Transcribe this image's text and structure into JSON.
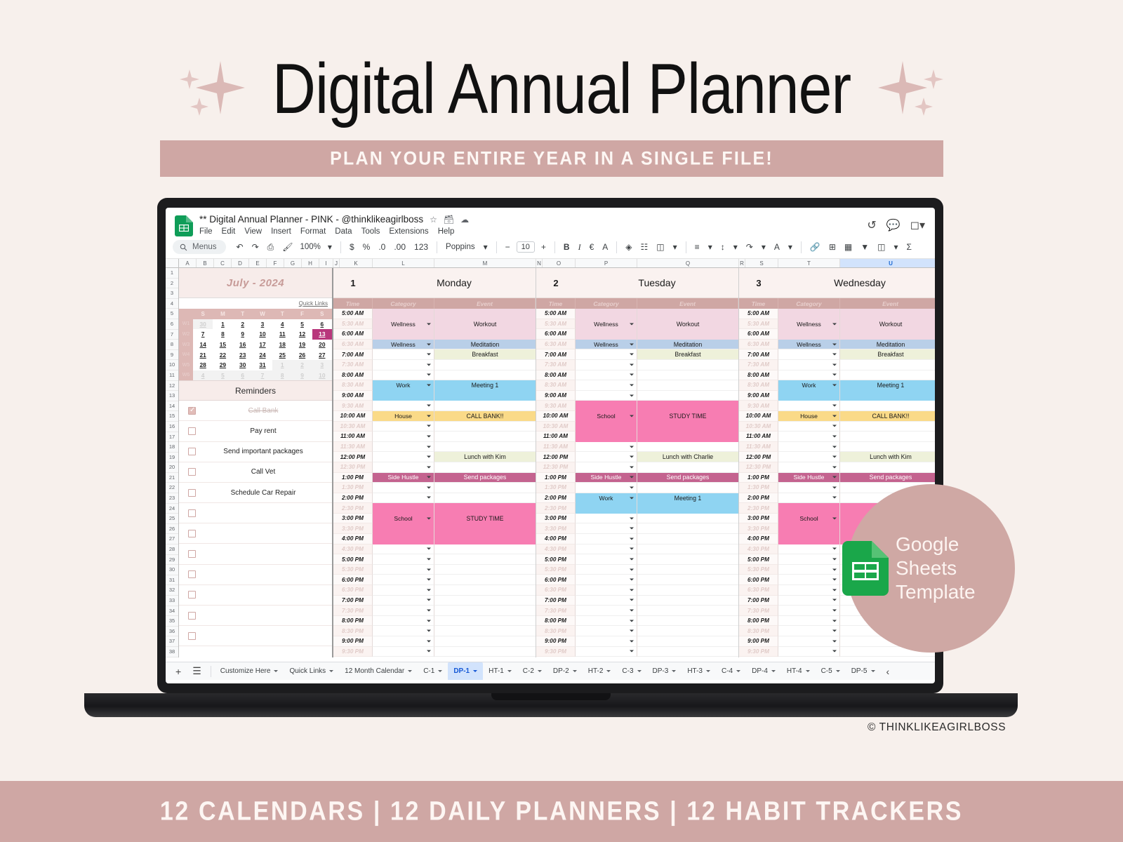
{
  "header": {
    "title": "Digital Annual Planner",
    "banner": "PLAN YOUR ENTIRE YEAR IN A SINGLE FILE!"
  },
  "footer": {
    "text": "12 CALENDARS | 12 DAILY PLANNERS |  12 HABIT TRACKERS"
  },
  "badge": {
    "line1": "Google",
    "line2": "Sheets",
    "line3": "Template"
  },
  "copyright": "© THINKLIKEAGIRLBOSS",
  "app": {
    "filename": "** Digital Annual Planner - PINK - @thinklikeagirlboss",
    "menus": [
      "File",
      "Edit",
      "View",
      "Insert",
      "Format",
      "Data",
      "Tools",
      "Extensions",
      "Help"
    ],
    "toolbar": {
      "search_label": "Menus",
      "zoom": "100%",
      "currency": "$",
      "percent": "%",
      "dec_dec": ".0",
      "dec_inc": ".00",
      "num_format": "123",
      "font": "Poppins",
      "font_size": "10",
      "minus": "−",
      "plus": "+",
      "bold": "B",
      "italic": "I",
      "sigma": "Σ"
    }
  },
  "grid": {
    "columns": [
      "A",
      "B",
      "C",
      "D",
      "E",
      "F",
      "G",
      "H",
      "I",
      "J",
      "K",
      "L",
      "M",
      "N",
      "O",
      "P",
      "Q",
      "R",
      "S",
      "T",
      "U"
    ],
    "selected_column": "U",
    "row_numbers": [
      1,
      2,
      3,
      4,
      5,
      6,
      7,
      8,
      9,
      10,
      11,
      12,
      13,
      14,
      15,
      16,
      17,
      18,
      19,
      20,
      21,
      22,
      23,
      24,
      25,
      26,
      27,
      28,
      29,
      30,
      31,
      32,
      33,
      34,
      35,
      36,
      37,
      38
    ]
  },
  "sidebar": {
    "month_title": "July - 2024",
    "quick_links": "Quick Links",
    "dow": [
      "S",
      "M",
      "T",
      "W",
      "T",
      "F",
      "S"
    ],
    "week_labels": [
      "W1",
      "W2",
      "W3",
      "W4",
      "W5",
      "W6"
    ],
    "weeks": [
      [
        {
          "d": "30",
          "dim": true
        },
        {
          "d": "1"
        },
        {
          "d": "2"
        },
        {
          "d": "3"
        },
        {
          "d": "4"
        },
        {
          "d": "5"
        },
        {
          "d": "6"
        }
      ],
      [
        {
          "d": "7"
        },
        {
          "d": "8"
        },
        {
          "d": "9"
        },
        {
          "d": "10"
        },
        {
          "d": "11"
        },
        {
          "d": "12"
        },
        {
          "d": "13",
          "today": true
        }
      ],
      [
        {
          "d": "14"
        },
        {
          "d": "15"
        },
        {
          "d": "16"
        },
        {
          "d": "17"
        },
        {
          "d": "18"
        },
        {
          "d": "19"
        },
        {
          "d": "20"
        }
      ],
      [
        {
          "d": "21"
        },
        {
          "d": "22"
        },
        {
          "d": "23"
        },
        {
          "d": "24"
        },
        {
          "d": "25"
        },
        {
          "d": "26"
        },
        {
          "d": "27"
        }
      ],
      [
        {
          "d": "28"
        },
        {
          "d": "29"
        },
        {
          "d": "30"
        },
        {
          "d": "31"
        },
        {
          "d": "1",
          "dim": true
        },
        {
          "d": "2",
          "dim": true
        },
        {
          "d": "3",
          "dim": true
        }
      ],
      [
        {
          "d": "4",
          "dim": true
        },
        {
          "d": "5",
          "dim": true
        },
        {
          "d": "6",
          "dim": true
        },
        {
          "d": "7",
          "dim": true
        },
        {
          "d": "8",
          "dim": true
        },
        {
          "d": "9",
          "dim": true
        },
        {
          "d": "10",
          "dim": true
        }
      ]
    ],
    "reminders_title": "Reminders",
    "reminders": [
      {
        "text": "Call Bank",
        "checked": true
      },
      {
        "text": "Pay rent",
        "checked": false
      },
      {
        "text": "Send important packages",
        "checked": false
      },
      {
        "text": "Call Vet",
        "checked": false
      },
      {
        "text": "Schedule Car Repair",
        "checked": false
      },
      {
        "text": "",
        "checked": false
      },
      {
        "text": "",
        "checked": false
      },
      {
        "text": "",
        "checked": false
      },
      {
        "text": "",
        "checked": false
      },
      {
        "text": "",
        "checked": false
      },
      {
        "text": "",
        "checked": false
      },
      {
        "text": "",
        "checked": false
      }
    ]
  },
  "schedule": {
    "sub_headers": [
      "Time",
      "Category",
      "Event"
    ],
    "times": [
      "5:00 AM",
      "5:30 AM",
      "6:00 AM",
      "6:30 AM",
      "7:00 AM",
      "7:30 AM",
      "8:00 AM",
      "8:30 AM",
      "9:00 AM",
      "9:30 AM",
      "10:00 AM",
      "10:30 AM",
      "11:00 AM",
      "11:30 AM",
      "12:00 PM",
      "12:30 PM",
      "1:00 PM",
      "1:30 PM",
      "2:00 PM",
      "2:30 PM",
      "3:00 PM",
      "3:30 PM",
      "4:00 PM",
      "4:30 PM",
      "5:00 PM",
      "5:30 PM",
      "6:00 PM",
      "6:30 PM",
      "7:00 PM",
      "7:30 PM",
      "8:00 PM",
      "8:30 PM",
      "9:00 PM",
      "9:30 PM"
    ],
    "colors": {
      "wellness_pink": "#f2d7e2",
      "wellness_blue": "#b9cfe8",
      "breakfast": "#eef1da",
      "work": "#8fd4f2",
      "house": "#fada88",
      "side_hustle": "#c4638f",
      "school": "#f77db2",
      "lunch": "#eef1da",
      "white": "#ffffff"
    },
    "days": [
      {
        "num": "1",
        "name": "Monday",
        "entries": [
          {
            "start": 0,
            "span": 3,
            "cat": "Wellness",
            "evt": "Workout",
            "bg": "#f2d7e2",
            "fg": "#1a1a1a"
          },
          {
            "start": 3,
            "span": 1,
            "cat": "Wellness",
            "evt": "Meditation",
            "bg": "#b9cfe8",
            "fg": "#1a1a1a"
          },
          {
            "start": 4,
            "span": 1,
            "cat": "",
            "evt": "Breakfast",
            "bg": "#eef1da",
            "fg": "#1a1a1a",
            "evtonly": true
          },
          {
            "start": 7,
            "span": 2,
            "cat": "Work",
            "evt": "Meeting 1",
            "bg": "#8fd4f2",
            "fg": "#1a1a1a"
          },
          {
            "start": 10,
            "span": 1,
            "cat": "House",
            "evt": "CALL BANK!!",
            "bg": "#fada88",
            "fg": "#1a1a1a"
          },
          {
            "start": 14,
            "span": 1,
            "cat": "",
            "evt": "Lunch with Kim",
            "bg": "#eef1da",
            "fg": "#1a1a1a",
            "evtonly": true
          },
          {
            "start": 16,
            "span": 1,
            "cat": "Side Hustle",
            "evt": "Send packages",
            "bg": "#c4638f",
            "fg": "#ffffff"
          },
          {
            "start": 19,
            "span": 4,
            "cat": "School",
            "evt": "STUDY TIME",
            "bg": "#f77db2",
            "fg": "#1a1a1a"
          }
        ]
      },
      {
        "num": "2",
        "name": "Tuesday",
        "entries": [
          {
            "start": 0,
            "span": 3,
            "cat": "Wellness",
            "evt": "Workout",
            "bg": "#f2d7e2",
            "fg": "#1a1a1a"
          },
          {
            "start": 3,
            "span": 1,
            "cat": "Wellness",
            "evt": "Meditation",
            "bg": "#b9cfe8",
            "fg": "#1a1a1a"
          },
          {
            "start": 4,
            "span": 1,
            "cat": "",
            "evt": "Breakfast",
            "bg": "#eef1da",
            "fg": "#1a1a1a",
            "evtonly": true
          },
          {
            "start": 9,
            "span": 4,
            "cat": "School",
            "evt": "STUDY TIME",
            "bg": "#f77db2",
            "fg": "#1a1a1a"
          },
          {
            "start": 14,
            "span": 1,
            "cat": "",
            "evt": "Lunch with Charlie",
            "bg": "#eef1da",
            "fg": "#1a1a1a",
            "evtonly": true
          },
          {
            "start": 16,
            "span": 1,
            "cat": "Side Hustle",
            "evt": "Send packages",
            "bg": "#c4638f",
            "fg": "#ffffff"
          },
          {
            "start": 18,
            "span": 2,
            "cat": "Work",
            "evt": "Meeting 1",
            "bg": "#8fd4f2",
            "fg": "#1a1a1a"
          }
        ]
      },
      {
        "num": "3",
        "name": "Wednesday",
        "entries": [
          {
            "start": 0,
            "span": 3,
            "cat": "Wellness",
            "evt": "Workout",
            "bg": "#f2d7e2",
            "fg": "#1a1a1a"
          },
          {
            "start": 3,
            "span": 1,
            "cat": "Wellness",
            "evt": "Meditation",
            "bg": "#b9cfe8",
            "fg": "#1a1a1a"
          },
          {
            "start": 4,
            "span": 1,
            "cat": "",
            "evt": "Breakfast",
            "bg": "#eef1da",
            "fg": "#1a1a1a",
            "evtonly": true
          },
          {
            "start": 7,
            "span": 2,
            "cat": "Work",
            "evt": "Meeting 1",
            "bg": "#8fd4f2",
            "fg": "#1a1a1a"
          },
          {
            "start": 10,
            "span": 1,
            "cat": "House",
            "evt": "CALL BANK!!",
            "bg": "#fada88",
            "fg": "#1a1a1a"
          },
          {
            "start": 14,
            "span": 1,
            "cat": "",
            "evt": "Lunch with Kim",
            "bg": "#eef1da",
            "fg": "#1a1a1a",
            "evtonly": true
          },
          {
            "start": 16,
            "span": 1,
            "cat": "Side Hustle",
            "evt": "Send packages",
            "bg": "#c4638f",
            "fg": "#ffffff"
          },
          {
            "start": 19,
            "span": 4,
            "cat": "School",
            "evt": "",
            "bg": "#f77db2",
            "fg": "#1a1a1a"
          }
        ]
      }
    ]
  },
  "sheet_tabs": [
    {
      "label": "Customize Here",
      "active": false
    },
    {
      "label": "Quick Links",
      "active": false
    },
    {
      "label": "12 Month Calendar",
      "active": false
    },
    {
      "label": "C-1",
      "active": false
    },
    {
      "label": "DP-1",
      "active": true
    },
    {
      "label": "HT-1",
      "active": false
    },
    {
      "label": "C-2",
      "active": false
    },
    {
      "label": "DP-2",
      "active": false
    },
    {
      "label": "HT-2",
      "active": false
    },
    {
      "label": "C-3",
      "active": false
    },
    {
      "label": "DP-3",
      "active": false
    },
    {
      "label": "HT-3",
      "active": false
    },
    {
      "label": "C-4",
      "active": false
    },
    {
      "label": "DP-4",
      "active": false
    },
    {
      "label": "HT-4",
      "active": false
    },
    {
      "label": "C-5",
      "active": false
    },
    {
      "label": "DP-5",
      "active": false
    }
  ]
}
